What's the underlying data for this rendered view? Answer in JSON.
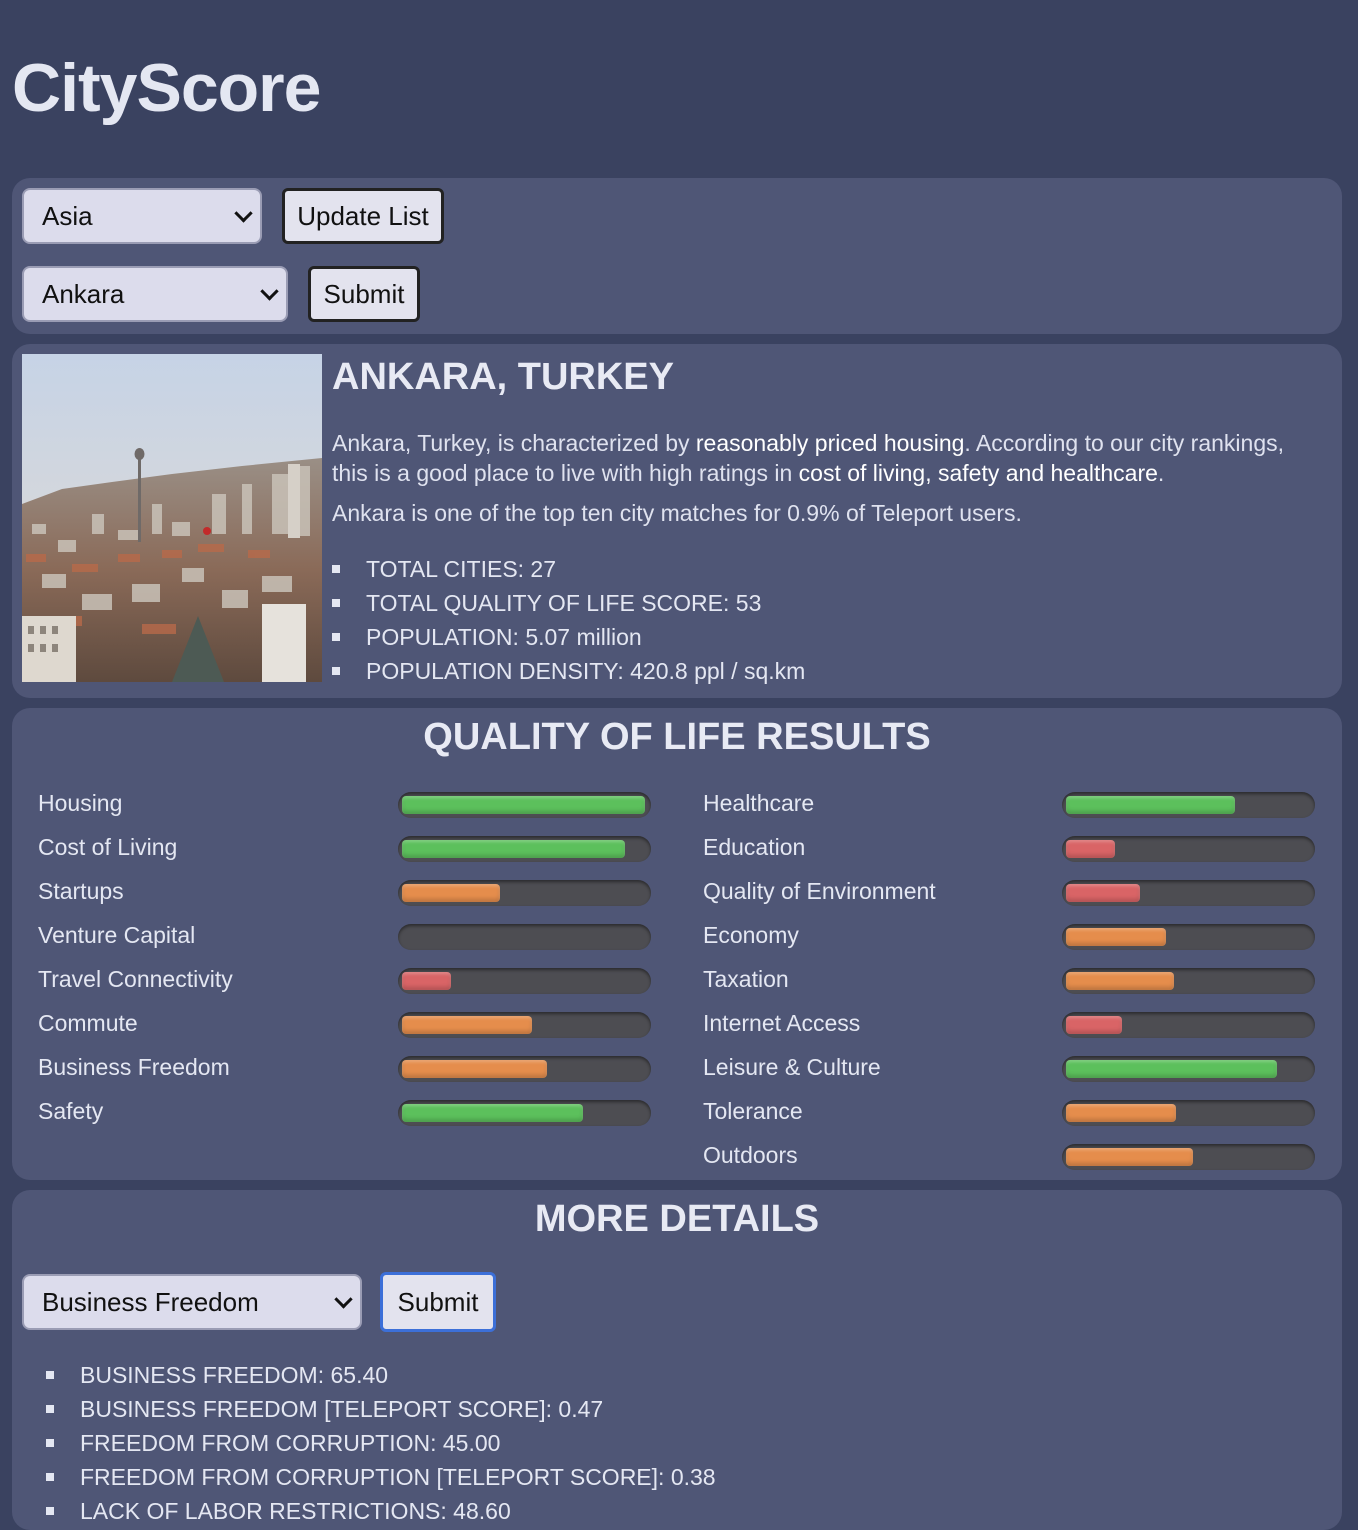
{
  "app": {
    "title": "CityScore"
  },
  "region_select": {
    "value": "Asia",
    "button_label": "Update List"
  },
  "city_select": {
    "value": "Ankara",
    "button_label": "Submit"
  },
  "city": {
    "name": "ANKARA, TURKEY",
    "summary_parts": [
      "Ankara, Turkey, is characterized by ",
      "reasonably priced housing",
      ". According to our city rankings, this is a good place to live with high ratings in ",
      "cost of living, safety and healthcare",
      "."
    ],
    "match_text": "Ankara is one of the top ten city matches for 0.9% of Teleport users.",
    "stats": [
      "TOTAL CITIES: 27",
      "TOTAL QUALITY OF LIFE SCORE: 53",
      "POPULATION: 5.07 million",
      "POPULATION DENSITY: 420.8 ppl / sq.km"
    ]
  },
  "qol": {
    "title": "QUALITY OF LIFE RESULTS",
    "colors": {
      "green": "#5cc05c",
      "orange": "#e58d4c",
      "red": "#d96466"
    },
    "left": [
      {
        "label": "Housing",
        "score": 0.99,
        "color": "green"
      },
      {
        "label": "Cost of Living",
        "score": 0.91,
        "color": "green"
      },
      {
        "label": "Startups",
        "score": 0.4,
        "color": "orange"
      },
      {
        "label": "Venture Capital",
        "score": 0.0,
        "color": "orange"
      },
      {
        "label": "Travel Connectivity",
        "score": 0.2,
        "color": "red"
      },
      {
        "label": "Commute",
        "score": 0.53,
        "color": "orange"
      },
      {
        "label": "Business Freedom",
        "score": 0.59,
        "color": "orange"
      },
      {
        "label": "Safety",
        "score": 0.74,
        "color": "green"
      }
    ],
    "right": [
      {
        "label": "Healthcare",
        "score": 0.69,
        "color": "green"
      },
      {
        "label": "Education",
        "score": 0.2,
        "color": "red"
      },
      {
        "label": "Quality of Environment",
        "score": 0.3,
        "color": "red"
      },
      {
        "label": "Economy",
        "score": 0.41,
        "color": "orange"
      },
      {
        "label": "Taxation",
        "score": 0.44,
        "color": "orange"
      },
      {
        "label": "Internet Access",
        "score": 0.23,
        "color": "red"
      },
      {
        "label": "Leisure & Culture",
        "score": 0.86,
        "color": "green"
      },
      {
        "label": "Tolerance",
        "score": 0.45,
        "color": "orange"
      },
      {
        "label": "Outdoors",
        "score": 0.52,
        "color": "orange"
      }
    ]
  },
  "more_details": {
    "title": "MORE DETAILS",
    "select_value": "Business Freedom",
    "button_label": "Submit",
    "items": [
      "BUSINESS FREEDOM: 65.40",
      "BUSINESS FREEDOM [TELEPORT SCORE]: 0.47",
      "FREEDOM FROM CORRUPTION: 45.00",
      "FREEDOM FROM CORRUPTION [TELEPORT SCORE]: 0.38",
      "LACK OF LABOR RESTRICTIONS: 48.60"
    ]
  }
}
